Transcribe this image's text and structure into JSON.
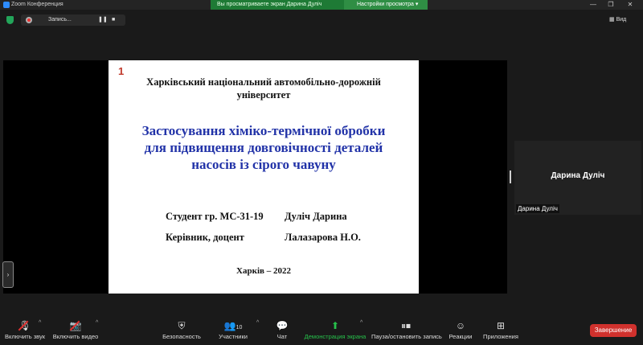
{
  "window": {
    "title": "Zoom Конференция",
    "share_banner": "Вы просматриваете экран Дарина Дуліч",
    "view_options": "Настройки просмотра",
    "min": "—",
    "max": "❐",
    "close": "✕"
  },
  "recording": {
    "label": "Запись...",
    "pause": "❚❚",
    "stop": "■"
  },
  "view_button": "Вид",
  "slide": {
    "number": "1",
    "university_line1": "Харківський національний автомобільно-дорожній",
    "university_line2": "університет",
    "title_line1": "Застосування хіміко-термічної обробки",
    "title_line2": "для підвищення довговічності деталей",
    "title_line3": "насосів із сірого чавуну",
    "student_label": "Студент гр. МС-31-19",
    "student_name": "Дуліч Дарина",
    "supervisor_label": "Керівник,  доцент",
    "supervisor_name": "Лалазарова Н.О.",
    "city_year": "Харків – 2022"
  },
  "participant": {
    "display_name": "Дарина Дуліч",
    "label": "Дарина Дуліч"
  },
  "toolbar": {
    "mute_label": "Включить звук",
    "video_label": "Включить видео",
    "security_label": "Безопасность",
    "participants_label": "Участники",
    "participants_count": "10",
    "chat_label": "Чат",
    "share_label": "Демонстрация экрана",
    "record_label": "Пауза/остановить запись",
    "reactions_label": "Реакции",
    "apps_label": "Приложения",
    "end_label": "Завершение"
  },
  "colors": {
    "share_green": "#1e7a35",
    "end_red": "#d0312d",
    "slide_title_blue": "#2233a8"
  }
}
